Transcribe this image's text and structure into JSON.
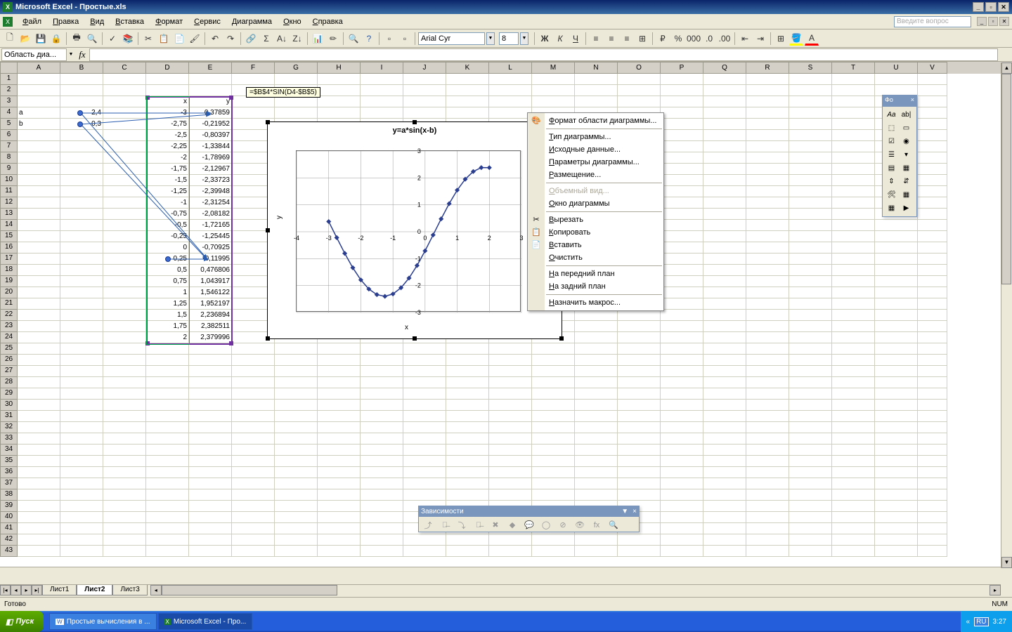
{
  "title_app": "Microsoft Excel",
  "title_doc": "Простые.xls",
  "menus": [
    "Файл",
    "Правка",
    "Вид",
    "Вставка",
    "Формат",
    "Сервис",
    "Диаграмма",
    "Окно",
    "Справка"
  ],
  "ask_placeholder": "Введите вопрос",
  "font_name": "Arial Cyr",
  "font_size": "8",
  "name_box": "Область диа...",
  "formula_tip": "=$B$4*SIN(D4-$B$5)",
  "status_left": "Готово",
  "status_num": "NUM",
  "sheets": [
    "Лист1",
    "Лист2",
    "Лист3"
  ],
  "active_sheet": 1,
  "start_label": "Пуск",
  "task1": "Простые вычисления в ...",
  "task2": "Microsoft Excel - Про...",
  "clock": "3:27",
  "dep_title": "Зависимости",
  "forms_title": "Фо",
  "cells": {
    "A4": "a",
    "B4": "2,4",
    "A5": "b",
    "B5": "0,3",
    "D3": "x",
    "E3": "y",
    "D4": "-3",
    "E4": "0,37859",
    "D5": "-2,75",
    "E5": "-0,21952",
    "D6": "-2,5",
    "E6": "-0,80397",
    "D7": "-2,25",
    "E7": "-1,33844",
    "D8": "-2",
    "E8": "-1,78969",
    "D9": "-1,75",
    "E9": "-2,12967",
    "D10": "-1,5",
    "E10": "-2,33723",
    "D11": "-1,25",
    "E11": "-2,39948",
    "D12": "-1",
    "E12": "-2,31254",
    "D13": "-0,75",
    "E13": "-2,08182",
    "D14": "-0,5",
    "E14": "-1,72165",
    "D15": "-0,25",
    "E15": "-1,25445",
    "D16": "0",
    "E16": "-0,70925",
    "D17": "0,25",
    "E17": "-0,11995",
    "D18": "0,5",
    "E18": "0,476806",
    "D19": "0,75",
    "E19": "1,043917",
    "D20": "1",
    "E20": "1,546122",
    "D21": "1,25",
    "E21": "1,952197",
    "D22": "1,5",
    "E22": "2,236894",
    "D23": "1,75",
    "E23": "2,382511",
    "D24": "2",
    "E24": "2,379996"
  },
  "chart_data": {
    "type": "line",
    "title": "y=a*sin(x-b)",
    "xlabel": "x",
    "ylabel": "y",
    "xlim": [
      -4,
      3
    ],
    "ylim": [
      -3,
      3
    ],
    "x": [
      -3,
      -2.75,
      -2.5,
      -2.25,
      -2,
      -1.75,
      -1.5,
      -1.25,
      -1,
      -0.75,
      -0.5,
      -0.25,
      0,
      0.25,
      0.5,
      0.75,
      1,
      1.25,
      1.5,
      1.75,
      2
    ],
    "y": [
      0.37859,
      -0.21952,
      -0.80397,
      -1.33844,
      -1.78969,
      -2.12967,
      -2.33723,
      -2.39948,
      -2.31254,
      -2.08182,
      -1.72165,
      -1.25445,
      -0.70925,
      -0.11995,
      0.476806,
      1.043917,
      1.546122,
      1.952197,
      2.236894,
      2.382511,
      2.379996
    ]
  },
  "context_menu": [
    {
      "label": "Формат области диаграммы...",
      "icon": "🎨"
    },
    {
      "sep": true
    },
    {
      "label": "Тип диаграммы..."
    },
    {
      "label": "Исходные данные..."
    },
    {
      "label": "Параметры диаграммы..."
    },
    {
      "label": "Размещение..."
    },
    {
      "sep": true
    },
    {
      "label": "Объемный вид...",
      "disabled": true
    },
    {
      "label": "Окно диаграммы"
    },
    {
      "sep": true
    },
    {
      "label": "Вырезать",
      "icon": "✂"
    },
    {
      "label": "Копировать",
      "icon": "📋"
    },
    {
      "label": "Вставить",
      "icon": "📄"
    },
    {
      "label": "Очистить"
    },
    {
      "sep": true
    },
    {
      "label": "На передний план"
    },
    {
      "label": "На задний план"
    },
    {
      "sep": true
    },
    {
      "label": "Назначить макрос..."
    }
  ],
  "columns": [
    "A",
    "B",
    "C",
    "D",
    "E",
    "F",
    "G",
    "H",
    "I",
    "J",
    "K",
    "L",
    "M",
    "N",
    "O",
    "P",
    "Q",
    "R",
    "S",
    "T",
    "U",
    "V"
  ]
}
